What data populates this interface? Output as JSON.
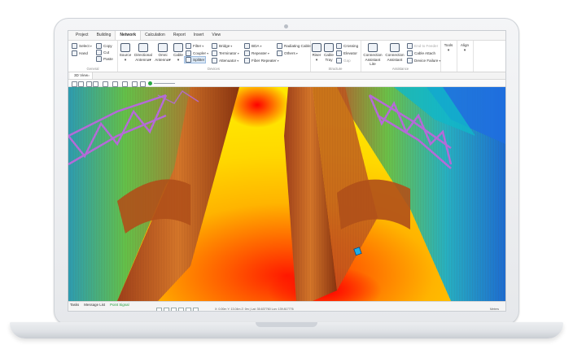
{
  "menu": {
    "tabs": [
      "Project",
      "Building",
      "Network",
      "Calculation",
      "Report",
      "Insert",
      "View"
    ],
    "active_index": 2
  },
  "ribbon": {
    "general": {
      "label": "General",
      "select": "Select",
      "hand": "Hand",
      "copy": "Copy",
      "cut": "Cut",
      "paste": "Paste"
    },
    "devices": {
      "label": "Devices",
      "source": "Source",
      "directional_antenna": [
        "Directional",
        "Antenna"
      ],
      "omni_antenna": [
        "Omni",
        "Antenna"
      ],
      "cable": "Cable",
      "filter": "Filter",
      "coupler": "Coupler",
      "splitter": "Splitter",
      "bridge": "Bridge",
      "terminator": "Terminator",
      "attenuator": "Attenuator",
      "bda": "BDA",
      "repeater": "Repeater",
      "fiber_repeater": "Fiber Repeater",
      "radiating_cable": "Radiating Cable",
      "others": "Others"
    },
    "structure": {
      "label": "Structure",
      "riser": "Riser",
      "cable_tray": [
        "Cable",
        "Tray"
      ],
      "crossing": "Crossing",
      "elevator": "Elevator",
      "gap": "Gap"
    },
    "assistance": {
      "label": "Assistance",
      "connection_assistant_lite": [
        "Connection",
        "Assistant Lite"
      ],
      "connection_assistant": [
        "Connection",
        "Assistant"
      ],
      "end_to_feeder": "End to Feeder",
      "cable_attach": "Cable Attach",
      "device_failure": "Device Failure"
    },
    "tools": "Tools",
    "align": "Align"
  },
  "document_tab": "3D View",
  "bottom_panel": {
    "tabs": [
      "Tasks",
      "Message List",
      "Point Signal"
    ],
    "coordinates": "X: 0.00m  Y: 13.04m  Z: 0m  |  Lat: 35.637760  Lon: 139.817776",
    "units": "Meters"
  },
  "heatmap_colors": {
    "hot": "#ff1a00",
    "warm": "#ff8a00",
    "mid": "#ffd800",
    "cool": "#5fd04a",
    "cold": "#10b8c8",
    "coldest": "#1f6fe0",
    "truss": "#b56ad8"
  }
}
